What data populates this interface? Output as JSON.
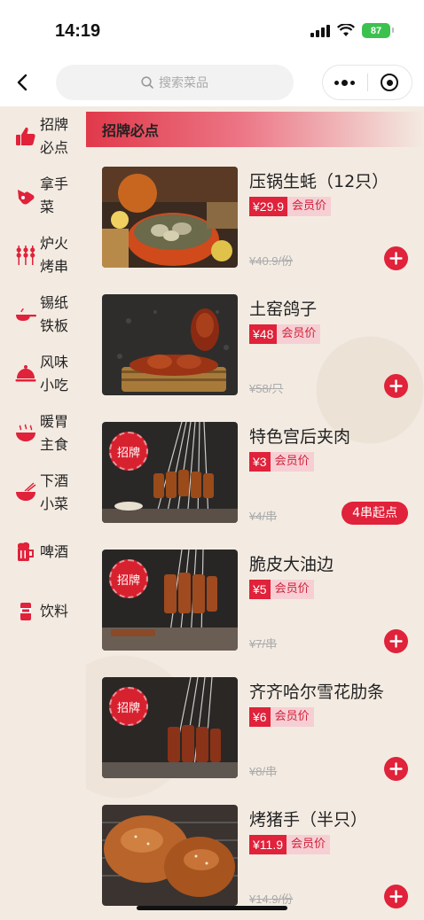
{
  "status_bar": {
    "time": "14:19",
    "battery": "87"
  },
  "nav": {
    "search_placeholder": "搜索菜品"
  },
  "categories": [
    {
      "label": "招牌必点",
      "icon": "thumbs-up-icon",
      "active": true
    },
    {
      "label": "拿手菜",
      "icon": "pointing-hand-icon"
    },
    {
      "label": "炉火烤串",
      "icon": "skewer-icon"
    },
    {
      "label": "锡纸铁板",
      "icon": "frying-pan-icon"
    },
    {
      "label": "风味小吃",
      "icon": "cloche-icon"
    },
    {
      "label": "暖胃主食",
      "icon": "steaming-bowl-icon"
    },
    {
      "label": "下酒小菜",
      "icon": "bowl-chopsticks-icon"
    },
    {
      "label": "啤酒",
      "icon": "beer-mug-icon"
    },
    {
      "label": "饮料",
      "icon": "drink-can-icon"
    }
  ],
  "section": {
    "title": "招牌必点"
  },
  "dishes": [
    {
      "name": "压锅生蚝（12只）",
      "price": "¥29.9",
      "member_label": "会员价",
      "original": "¥40.9/份",
      "badge": "",
      "action": "add"
    },
    {
      "name": "土窑鸽子",
      "price": "¥48",
      "member_label": "会员价",
      "original": "¥58/只",
      "badge": "",
      "action": "add"
    },
    {
      "name": "特色宫后夹肉",
      "price": "¥3",
      "member_label": "会员价",
      "original": "¥4/串",
      "badge": "招牌",
      "action": "min",
      "min_label": "4串起点"
    },
    {
      "name": "脆皮大油边",
      "price": "¥5",
      "member_label": "会员价",
      "original": "¥7/串",
      "badge": "招牌",
      "action": "add"
    },
    {
      "name": "齐齐哈尔雪花肋条",
      "price": "¥6",
      "member_label": "会员价",
      "original": "¥8/串",
      "badge": "招牌",
      "action": "add"
    },
    {
      "name": "烤猪手（半只）",
      "price": "¥11.9",
      "member_label": "会员价",
      "original": "¥14.9/份",
      "badge": "",
      "action": "add"
    }
  ],
  "colors": {
    "accent": "#e0223a",
    "background": "#f3ebe2",
    "member_bg": "#f6cfd4"
  }
}
